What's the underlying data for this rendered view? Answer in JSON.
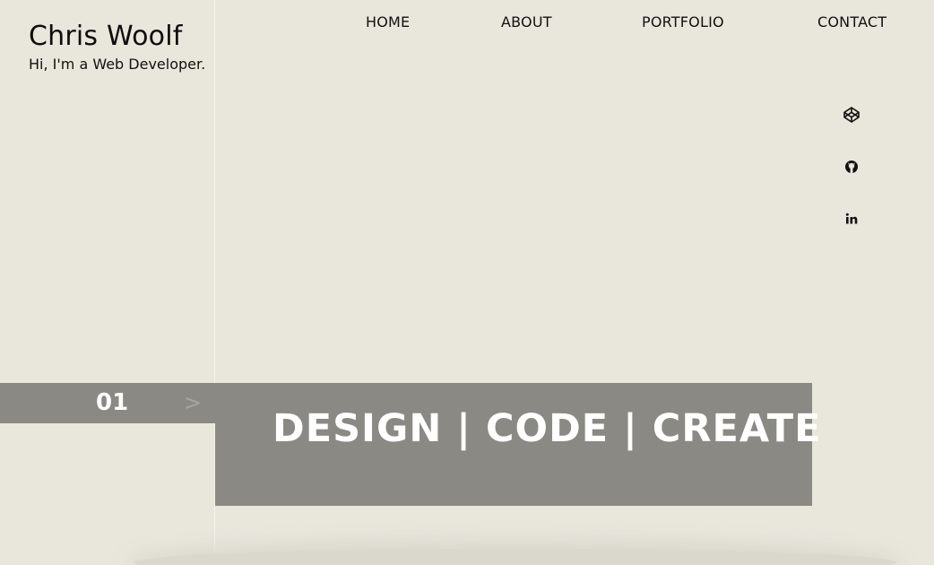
{
  "brand": {
    "name": "Chris Woolf",
    "tagline": "Hi, I'm a Web Developer."
  },
  "nav": {
    "items": [
      {
        "label": "HOME"
      },
      {
        "label": "ABOUT"
      },
      {
        "label": "PORTFOLIO"
      },
      {
        "label": "CONTACT"
      }
    ]
  },
  "social": {
    "icons": [
      "codepen-icon",
      "github-icon",
      "linkedin-icon"
    ]
  },
  "slider": {
    "index": "01",
    "arrow": ">",
    "headline": "DESIGN | CODE | CREATE"
  },
  "colors": {
    "background": "#e9e6dc",
    "banner": "#8b8984",
    "banner_text": "#ffffff",
    "text": "#111111"
  }
}
